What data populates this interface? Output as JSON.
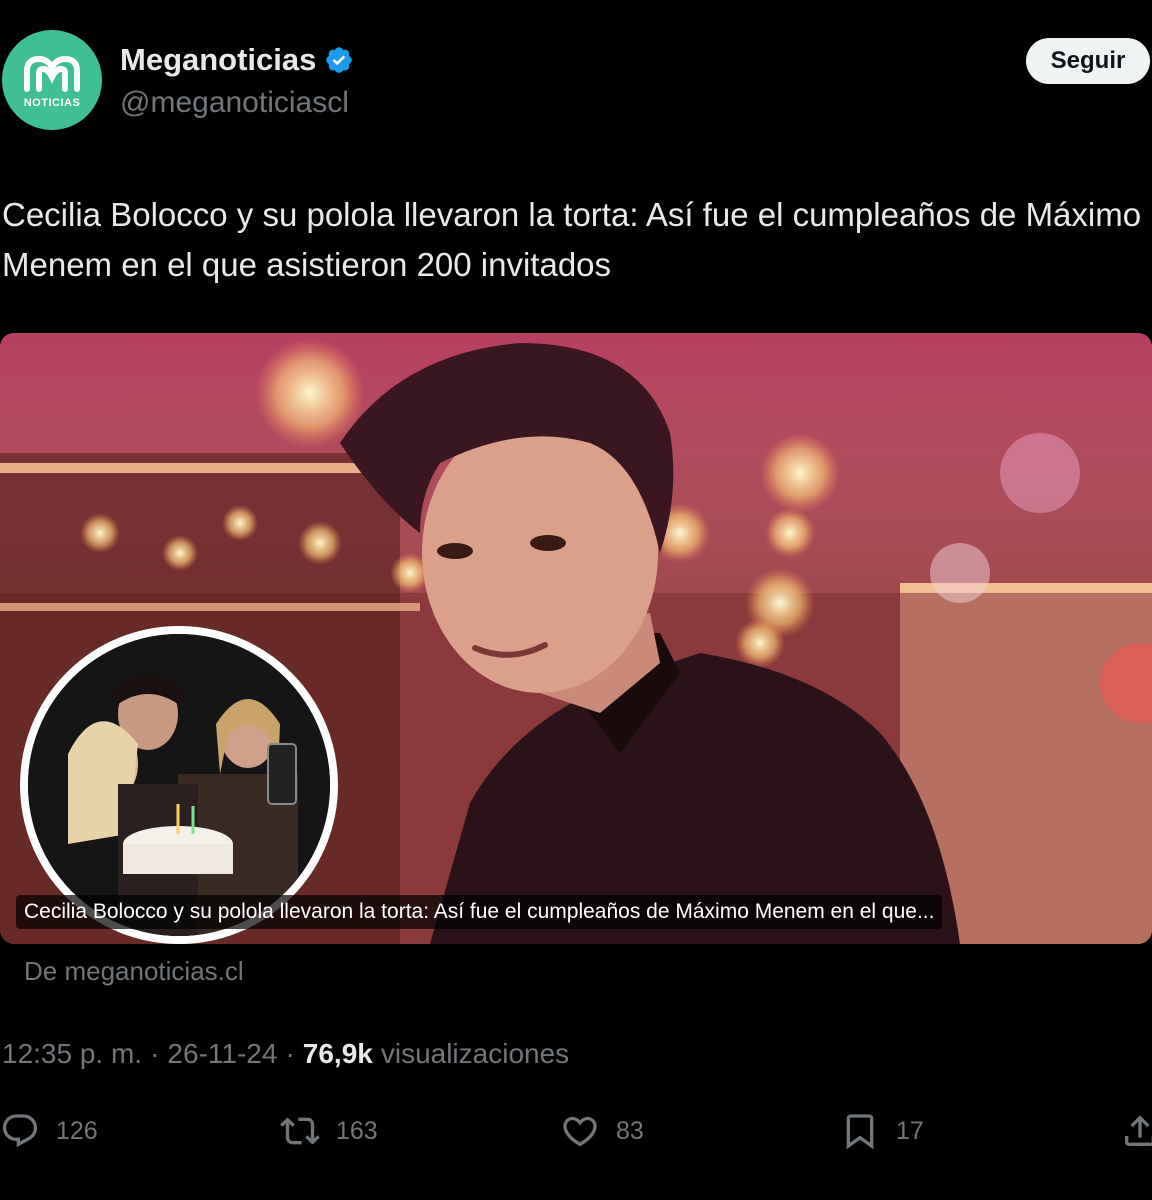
{
  "account": {
    "name": "Meganoticias",
    "handle": "@meganoticiascl",
    "avatar_label": "NOTICIAS",
    "follow_label": "Seguir",
    "avatar_color": "#3fbf93",
    "verified_color": "#1d9bf0"
  },
  "tweet": {
    "text": "Cecilia Bolocco y su polola llevaron la torta: Así fue el cumpleaños de Máximo Menem en el que asistieron 200 invitados"
  },
  "card": {
    "caption": "Cecilia Bolocco y su polola llevaron la torta: Así fue el cumpleaños de Máximo Menem en el que...",
    "source": "De meganoticias.cl"
  },
  "meta": {
    "time": "12:35 p. m.",
    "separator1": "·",
    "date": "26-11-24",
    "separator2": "·",
    "views_count": "76,9k",
    "views_label": "visualizaciones"
  },
  "actions": {
    "replies": "126",
    "reposts": "163",
    "likes": "83",
    "bookmarks": "17"
  }
}
